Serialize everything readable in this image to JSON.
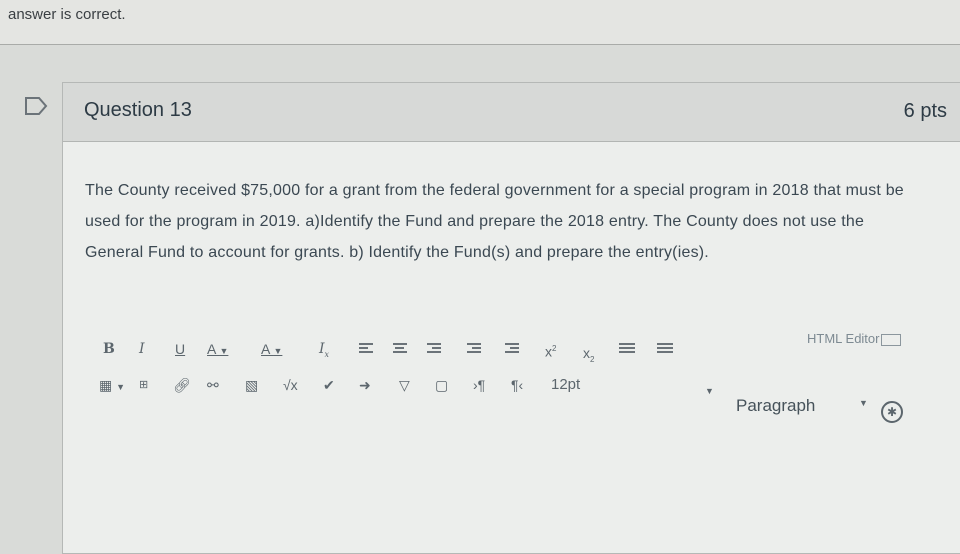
{
  "status_text": "answer is correct.",
  "question": {
    "title": "Question 13",
    "points": "6 pts",
    "body": "The County received $75,000 for a grant from the federal government for a special program in 2018 that must be used for the program in 2019. a)Identify the Fund and prepare the 2018 entry. The County does not use the General Fund to account for grants. b) Identify the Fund(s) and prepare the entry(ies)."
  },
  "editor": {
    "html_editor_label": "HTML Editor",
    "font_size": "12pt",
    "block_format": "Paragraph",
    "toolbar_row1": [
      "bold-icon",
      "italic-icon",
      "underline-icon",
      "text-color-icon",
      "background-color-icon",
      "clear-formatting-icon",
      "align-left-icon",
      "align-center-icon",
      "align-right-icon",
      "outdent-icon",
      "indent-icon",
      "superscript-icon",
      "subscript-icon",
      "bullet-list-icon",
      "numbered-list-icon"
    ],
    "toolbar_row2": [
      "table-icon",
      "embed-icon",
      "link-icon",
      "unlink-icon",
      "image-icon",
      "equation-icon",
      "media-icon",
      "lti-tool-icon",
      "google-drive-icon",
      "document-icon",
      "ltr-icon",
      "rtl-icon"
    ]
  }
}
